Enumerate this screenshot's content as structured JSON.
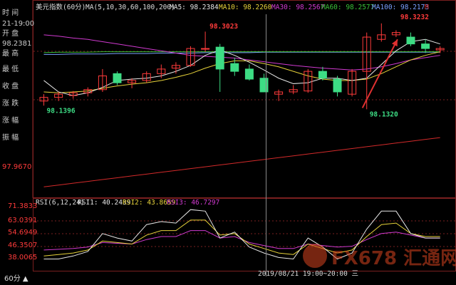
{
  "header": {
    "title": "美元指数(60分)",
    "ma_label": "MA(5,10,30,60,100,200)",
    "ma5": "MA5: 98.2384",
    "ma10": "MA10: 98.2260",
    "ma30": "MA30: 98.2567",
    "ma60": "MA60: 98.2577",
    "ma100": "MA100: 98.2173",
    "ma_extra": "M"
  },
  "info_panel": {
    "time_label": "时 间",
    "time_value": "21-19:00",
    "open_label": "开 盘",
    "open_value": "98.2381",
    "high_label": "最 高",
    "low_label": "最 低",
    "close_label": "收 盘",
    "change_label": "涨 跌",
    "amp_label": "涨 幅",
    "swing_label": "振 幅"
  },
  "price_axis": {
    "label_97967": "97.9670"
  },
  "annotations": {
    "high_peak": "98.3023",
    "top_right": "98.3232",
    "low_left": "98.1396",
    "low_mid": "98.1320"
  },
  "rsi": {
    "title": "RSI(6,12,24)",
    "rsi1": "RSI1: 40.2439",
    "rsi2": "RSI2: 43.8659",
    "rsi3": "RSI3: 46.7297",
    "ticks": [
      "71.3833",
      "63.0391",
      "54.6949",
      "46.3507",
      "38.0065"
    ]
  },
  "cursor_label": "2019/08/21 19:00~20:00 三",
  "timeframe_button": "60分 ▲",
  "watermark": "FX678 汇通网",
  "colors": {
    "up": "#ff3b3b",
    "down": "#3ddc84",
    "ma5": "#e6e6e6",
    "ma10": "#e6d23a",
    "ma30": "#d03ad0",
    "ma60": "#39c039",
    "ma100": "#7aa0ff",
    "ma200": "#d22a2a",
    "grid": "#7a1f1f",
    "label_up": "#ff3b3b",
    "label_down": "#3ddc84"
  },
  "chart_data": {
    "type": "candlestick",
    "symbol": "美元指数",
    "interval": "60分",
    "ylim": [
      97.95,
      98.34
    ],
    "candles": [
      {
        "o": 98.15,
        "h": 98.165,
        "l": 98.14,
        "c": 98.158
      },
      {
        "o": 98.158,
        "h": 98.17,
        "l": 98.15,
        "c": 98.165
      },
      {
        "o": 98.162,
        "h": 98.172,
        "l": 98.155,
        "c": 98.168
      },
      {
        "o": 98.168,
        "h": 98.18,
        "l": 98.16,
        "c": 98.175
      },
      {
        "o": 98.175,
        "h": 98.22,
        "l": 98.17,
        "c": 98.205
      },
      {
        "o": 98.21,
        "h": 98.215,
        "l": 98.185,
        "c": 98.19
      },
      {
        "o": 98.19,
        "h": 98.2,
        "l": 98.178,
        "c": 98.195
      },
      {
        "o": 98.195,
        "h": 98.215,
        "l": 98.19,
        "c": 98.21
      },
      {
        "o": 98.21,
        "h": 98.23,
        "l": 98.2,
        "c": 98.22
      },
      {
        "o": 98.222,
        "h": 98.235,
        "l": 98.21,
        "c": 98.228
      },
      {
        "o": 98.228,
        "h": 98.27,
        "l": 98.225,
        "c": 98.265
      },
      {
        "o": 98.265,
        "h": 98.302,
        "l": 98.258,
        "c": 98.265
      },
      {
        "o": 98.268,
        "h": 98.275,
        "l": 98.17,
        "c": 98.22
      },
      {
        "o": 98.232,
        "h": 98.245,
        "l": 98.205,
        "c": 98.215
      },
      {
        "o": 98.22,
        "h": 98.23,
        "l": 98.195,
        "c": 98.198
      },
      {
        "o": 98.2,
        "h": 98.21,
        "l": 98.17,
        "c": 98.17
      },
      {
        "o": 98.165,
        "h": 98.175,
        "l": 98.15,
        "c": 98.17
      },
      {
        "o": 98.17,
        "h": 98.185,
        "l": 98.165,
        "c": 98.175
      },
      {
        "o": 98.172,
        "h": 98.22,
        "l": 98.168,
        "c": 98.215
      },
      {
        "o": 98.215,
        "h": 98.225,
        "l": 98.195,
        "c": 98.2
      },
      {
        "o": 98.198,
        "h": 98.205,
        "l": 98.16,
        "c": 98.17
      },
      {
        "o": 98.165,
        "h": 98.22,
        "l": 98.16,
        "c": 98.215
      },
      {
        "o": 98.215,
        "h": 98.3,
        "l": 98.132,
        "c": 98.29
      },
      {
        "o": 98.285,
        "h": 98.32,
        "l": 98.28,
        "c": 98.295
      },
      {
        "o": 98.295,
        "h": 98.305,
        "l": 98.29,
        "c": 98.3
      },
      {
        "o": 98.29,
        "h": 98.3,
        "l": 98.27,
        "c": 98.275
      },
      {
        "o": 98.275,
        "h": 98.285,
        "l": 98.255,
        "c": 98.265
      },
      {
        "o": 98.262,
        "h": 98.27,
        "l": 98.255,
        "c": 98.265
      }
    ],
    "ma5": [
      98.195,
      98.17,
      98.162,
      98.168,
      98.18,
      98.195,
      98.198,
      98.2,
      98.205,
      98.215,
      98.228,
      98.25,
      98.262,
      98.25,
      98.235,
      98.218,
      98.2,
      98.188,
      98.19,
      98.2,
      98.2,
      98.195,
      98.2,
      98.23,
      98.26,
      98.28,
      98.285,
      98.275
    ],
    "ma10": [
      98.17,
      98.168,
      98.17,
      98.172,
      98.178,
      98.183,
      98.187,
      98.19,
      98.195,
      98.202,
      98.21,
      98.222,
      98.232,
      98.238,
      98.238,
      98.232,
      98.225,
      98.215,
      98.205,
      98.198,
      98.195,
      98.195,
      98.198,
      98.21,
      98.225,
      98.24,
      98.25,
      98.258
    ],
    "ma30": [
      98.295,
      98.292,
      98.288,
      98.285,
      98.28,
      98.275,
      98.27,
      98.265,
      98.26,
      98.255,
      98.25,
      98.248,
      98.246,
      98.244,
      98.24,
      98.236,
      98.232,
      98.228,
      98.225,
      98.222,
      98.22,
      98.218,
      98.22,
      98.225,
      98.232,
      98.24,
      98.245,
      98.25
    ],
    "ma60": [
      98.256,
      98.257,
      98.257,
      98.257,
      98.258,
      98.258,
      98.258,
      98.258,
      98.258,
      98.258,
      98.258,
      98.258,
      98.258,
      98.258,
      98.258,
      98.258,
      98.258,
      98.258,
      98.258,
      98.258,
      98.258,
      98.258,
      98.258,
      98.258,
      98.258,
      98.258,
      98.258,
      98.258
    ],
    "ma100": [
      98.252,
      98.252,
      98.253,
      98.253,
      98.253,
      98.254,
      98.254,
      98.254,
      98.255,
      98.255,
      98.255,
      98.256,
      98.256,
      98.256,
      98.256,
      98.257,
      98.257,
      98.257,
      98.257,
      98.257,
      98.257,
      98.257,
      98.257,
      98.257,
      98.257,
      98.257,
      98.257,
      98.257
    ],
    "ma200": [
      97.962,
      97.966,
      97.97,
      97.974,
      97.978,
      97.982,
      97.986,
      97.99,
      97.994,
      97.998,
      98.002,
      98.006,
      98.01,
      98.014,
      98.018,
      98.022,
      98.026,
      98.03,
      98.034,
      98.038,
      98.042,
      98.046,
      98.05,
      98.054,
      98.058,
      98.062,
      98.066,
      98.07
    ],
    "rsi": {
      "ylim": [
        33,
        73
      ],
      "rsi1": [
        38.0,
        38.0,
        40.0,
        43.0,
        55.0,
        52.0,
        50.0,
        61.0,
        63.0,
        62.0,
        71.0,
        70.0,
        52.0,
        56.0,
        46.0,
        42.0,
        39.0,
        38.0,
        52.0,
        46.0,
        38.0,
        42.0,
        58.0,
        70.0,
        70.0,
        55.0,
        52.0,
        52.0
      ],
      "rsi2": [
        40.0,
        41.0,
        42.0,
        44.0,
        50.0,
        49.0,
        48.0,
        54.0,
        57.0,
        57.0,
        64.0,
        64.0,
        54.0,
        55.0,
        48.0,
        45.0,
        42.0,
        41.0,
        48.0,
        45.0,
        42.0,
        44.0,
        53.0,
        61.0,
        62.0,
        55.0,
        53.0,
        53.0
      ],
      "rsi3": [
        44.0,
        44.5,
        45.0,
        46.0,
        49.0,
        48.5,
        48.0,
        51.0,
        53.0,
        53.0,
        57.0,
        57.0,
        52.0,
        53.0,
        49.0,
        47.0,
        45.0,
        45.0,
        48.0,
        47.0,
        46.0,
        46.5,
        51.0,
        55.0,
        56.0,
        54.0,
        52.0,
        52.0
      ]
    },
    "annotations": [
      {
        "label": "98.3023",
        "x_index": 11,
        "value": 98.3023
      },
      {
        "label": "98.3232",
        "x_index": 24,
        "value": 98.3232
      },
      {
        "label": "98.1396",
        "x_index": 0,
        "value": 98.1396
      },
      {
        "label": "98.1320",
        "x_index": 22,
        "value": 98.132
      }
    ],
    "cursor_index": 15,
    "grid": true
  }
}
